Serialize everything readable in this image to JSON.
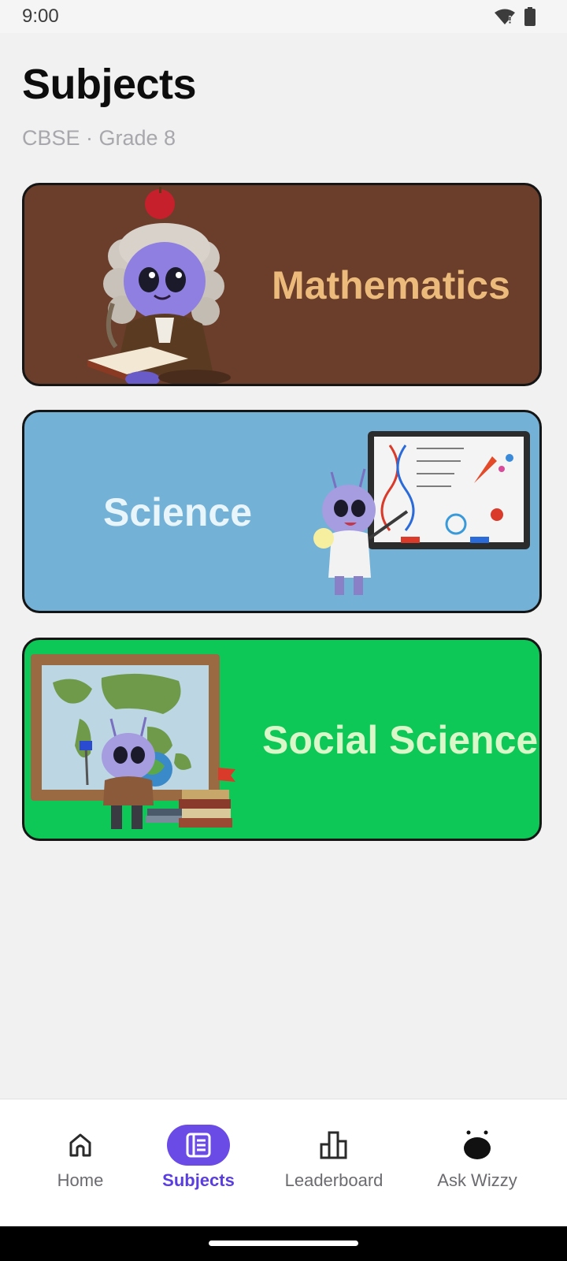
{
  "status_bar": {
    "time": "9:00",
    "icons": [
      "wifi-icon",
      "battery-icon"
    ]
  },
  "header": {
    "title": "Subjects",
    "subtitle": "CBSE · Grade 8"
  },
  "subjects": [
    {
      "label": "Mathematics",
      "background": "#6a3e2b",
      "text_color": "#ecbb7c"
    },
    {
      "label": "Science",
      "background": "#73b1d7",
      "text_color": "#e8f5fb"
    },
    {
      "label": "Social Science",
      "background": "#0dc857",
      "text_color": "#d9f7c8"
    }
  ],
  "bottom_nav": {
    "items": [
      {
        "label": "Home",
        "icon": "home-icon",
        "active": false
      },
      {
        "label": "Subjects",
        "icon": "book-icon",
        "active": true
      },
      {
        "label": "Leaderboard",
        "icon": "bar-chart-icon",
        "active": false
      },
      {
        "label": "Ask Wizzy",
        "icon": "wizzy-icon",
        "active": false
      }
    ],
    "accent": "#6b4be6"
  }
}
